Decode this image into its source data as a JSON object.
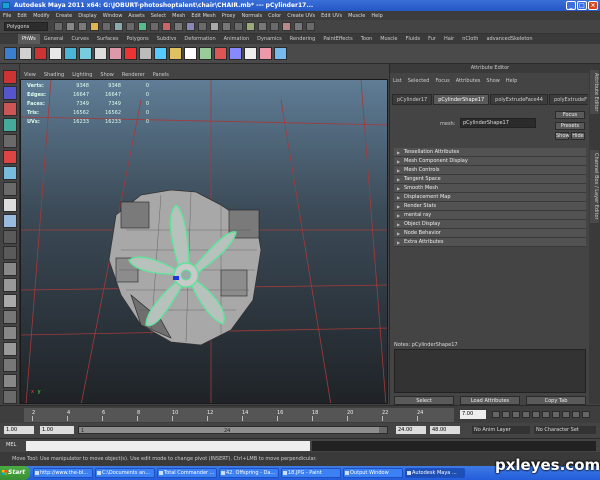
{
  "window": {
    "title": "Autodesk Maya 2011 x64: G:\\JOBURT-photoshoptalent\\chair\\CHAIR.mb* --- pCylinder17...",
    "minimize": "_",
    "maximize": "□",
    "close": "×"
  },
  "menubar": [
    "File",
    "Edit",
    "Modify",
    "Create",
    "Display",
    "Window",
    "Assets",
    "Select",
    "Mesh",
    "Edit Mesh",
    "Proxy",
    "Normals",
    "Color",
    "Create UVs",
    "Edit UVs",
    "Muscle",
    "Help"
  ],
  "status_line": {
    "mode": "Polygons"
  },
  "shelf_tabs": [
    "PhWs",
    "General",
    "Curves",
    "Surfaces",
    "Polygons",
    "Subdivs",
    "Deformation",
    "Animation",
    "Dynamics",
    "Rendering",
    "PaintEffects",
    "Toon",
    "Muscle",
    "Fluids",
    "Fur",
    "Hair",
    "nCloth",
    "advancedSkeleton"
  ],
  "shelf_active": "PhWs",
  "viewport": {
    "menu": [
      "View",
      "Shading",
      "Lighting",
      "Show",
      "Renderer",
      "Panels"
    ],
    "hud": [
      {
        "label": "Verts:",
        "a": "9348",
        "b": "9348",
        "c": "0"
      },
      {
        "label": "Edges:",
        "a": "16647",
        "b": "16647",
        "c": "0"
      },
      {
        "label": "Faces:",
        "a": "7349",
        "b": "7349",
        "c": "0"
      },
      {
        "label": "Tris:",
        "a": "16562",
        "b": "16562",
        "c": "0"
      },
      {
        "label": "UVs:",
        "a": "16233",
        "b": "16233",
        "c": "0"
      }
    ],
    "axis_x": "x",
    "axis_y": "y"
  },
  "attribute_editor": {
    "title": "Attribute Editor",
    "menu": [
      "List",
      "Selected",
      "Focus",
      "Attributes",
      "Show",
      "Help"
    ],
    "tabs": [
      "pCylinder17",
      "pCylinderShape17",
      "polyExtrudeFace44",
      "polyExtrudeF"
    ],
    "active_tab": "pCylinderShape17",
    "mesh_label": "mesh:",
    "mesh_value": "pCylinderShape17",
    "focus": "Focus",
    "presets": "Presets",
    "show": "Show",
    "hide": "Hide",
    "sections": [
      "Tessellation Attributes",
      "Mesh Component Display",
      "Mesh Controls",
      "Tangent Space",
      "Smooth Mesh",
      "Displacement Map",
      "Render Stats",
      "mental ray",
      "Object Display",
      "Node Behavior",
      "Extra Attributes"
    ],
    "notes_label": "Notes: pCylinderShape17",
    "buttons": {
      "select": "Select",
      "load": "Load Attributes",
      "copy": "Copy Tab"
    }
  },
  "side_tabs": [
    "Attribute Editor",
    "Channel Box / Layer Editor"
  ],
  "timeline": {
    "ticks": [
      "2",
      "4",
      "6",
      "8",
      "10",
      "12",
      "14",
      "16",
      "18",
      "20",
      "22",
      "24"
    ],
    "current_frame": "7.00"
  },
  "range": {
    "start": "1.00",
    "inner_start": "1.00",
    "bar_start": "1",
    "bar_end": "24",
    "end": "24.00",
    "end2": "48.00",
    "anim_layer": "No Anim Layer",
    "char_set": "No Character Set"
  },
  "mel": {
    "label": "MEL"
  },
  "help_line": "Move Tool: Use manipulator to move object(s). Use edit mode to change pivot (INSERT). Ctrl+LMB to move perpendicular.",
  "taskbar": {
    "start": "Start",
    "tasks": [
      "http://www.the-bl...",
      "C:\\Documents an...",
      "Total Commander ...",
      "42. Offspring - Da...",
      "18.JPG - Paint",
      "Output Window",
      "Autodesk Maya ..."
    ],
    "active_index": 6
  },
  "watermark": "pxleyes.com",
  "colors": {
    "selection_green": "#5fe39a",
    "grid_red": "#a33a3a",
    "viewport_top": "#5f7d96",
    "viewport_bottom": "#1f2327"
  }
}
